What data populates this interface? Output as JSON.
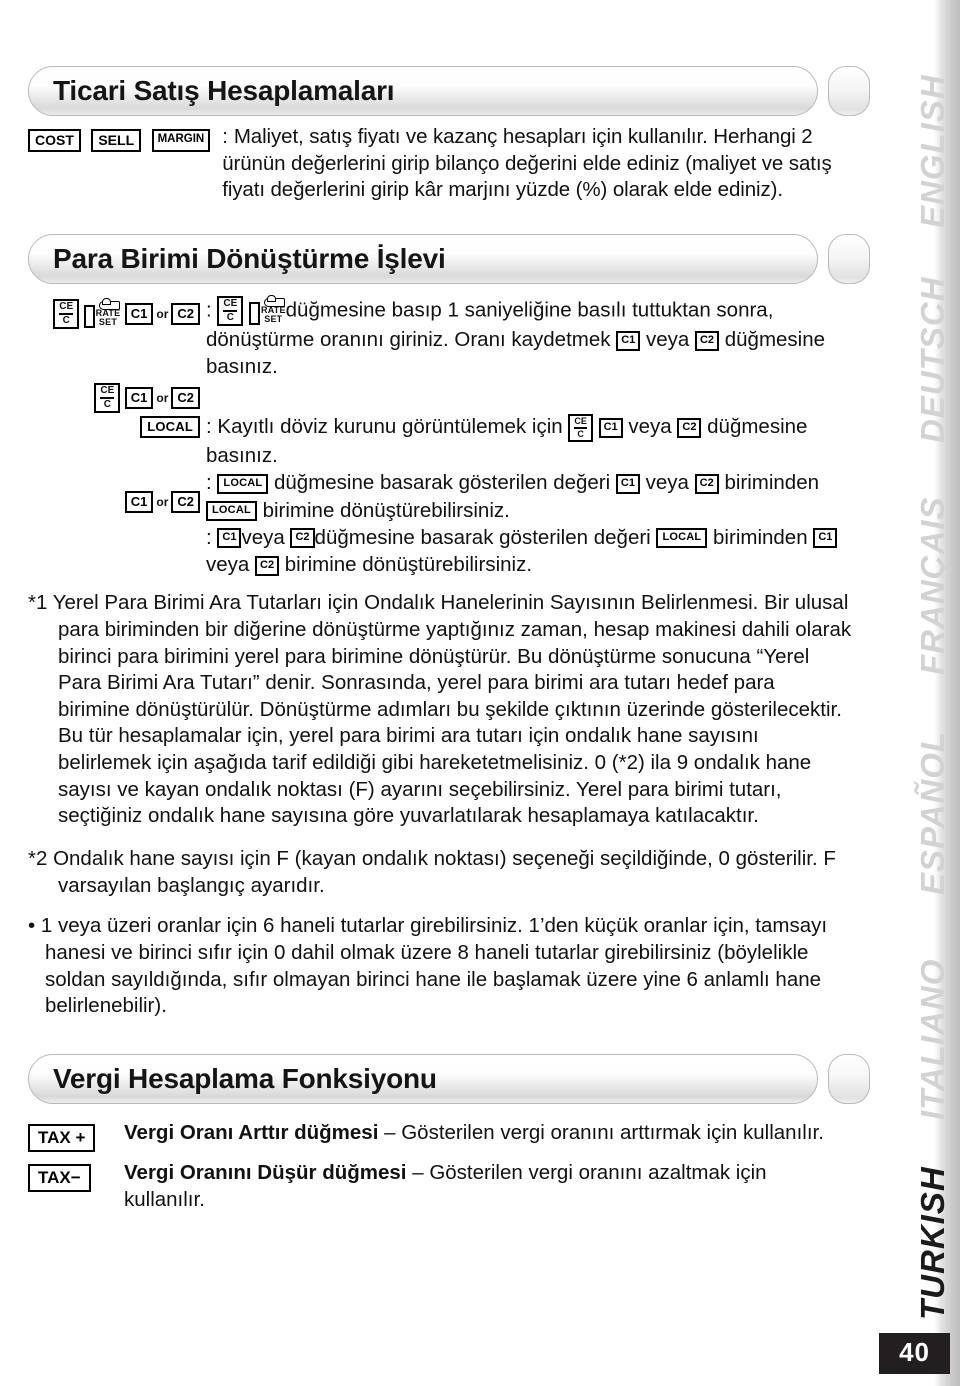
{
  "page": {
    "number": "40"
  },
  "language_rail": {
    "items": [
      {
        "label": "ENGLISH",
        "active": false
      },
      {
        "label": "DEUTSCH",
        "active": false
      },
      {
        "label": "FRANÇAIS",
        "active": false
      },
      {
        "label": "ESPAÑOL",
        "active": false
      },
      {
        "label": "ITALIANO",
        "active": false
      },
      {
        "label": "TURKISH",
        "active": true
      }
    ],
    "inactive_color": "#d2d2d2",
    "active_color": "#1b1b1b"
  },
  "sections": {
    "sales": {
      "heading": "Ticari Satış Hesaplamaları",
      "keys": [
        {
          "label": "COST"
        },
        {
          "label": "SELL"
        },
        {
          "label": "MARGIN"
        }
      ],
      "colon": ":",
      "description": "Maliyet, satış fiyatı ve kazanç hesapları için kullanılır. Herhangi 2 ürünün değerlerini girip bilanço değerini elde ediniz (maliyet ve satış fiyatı değerlerini girip kâr marjını yüzde (%) olarak elde ediniz)."
    },
    "currency": {
      "heading": "Para Birimi Dönüştürme İşlevi",
      "keys": {
        "ce_top": "CE",
        "ce_bottom": "C",
        "rate_line1": "RATE",
        "rate_line2": "SET",
        "c1": "C1",
        "c2": "C2",
        "or": "or",
        "local": "LOCAL"
      },
      "rows": [
        {
          "colon": ":",
          "text_a": "düğmesine basıp 1 saniyeliğine basılı tuttuktan sonra, dönüştürme oranını giriniz. Oranı kaydetmek",
          "text_b": "veya",
          "text_c": "düğmesine basınız."
        },
        {
          "colon": ":",
          "text_a": "Kayıtlı döviz kurunu görüntülemek için",
          "text_b": "veya",
          "text_c": "düğmesine basınız."
        },
        {
          "colon": ":",
          "text_a": "düğmesine basarak gösterilen değeri",
          "text_b": "veya",
          "text_c": "biriminden",
          "text_d": "birimine dönüştürebilirsiniz."
        },
        {
          "colon": ":",
          "text_a": "veya",
          "text_b": "düğmesine basarak gösterilen değeri",
          "text_c": "biriminden",
          "text_d": "veya",
          "text_e": "birimine dönüştürebilirsiniz."
        }
      ],
      "note1": "*1 Yerel Para Birimi Ara Tutarları için Ondalık Hanelerinin Sayısının Belirlenmesi. Bir ulusal para biriminden bir diğerine dönüştürme yaptığınız zaman, hesap makinesi dahili olarak birinci para birimini yerel para birimine dönüştürür. Bu dönüştürme sonucuna “Yerel Para Birimi Ara Tutarı” denir. Sonrasında, yerel para birimi ara tutarı hedef para birimine dönüştürülür. Dönüştürme adımları bu şekilde çıktının üzerinde gösterilecektir. Bu tür hesaplamalar için, yerel para birimi ara tutarı için ondalık hane sayısını belirlemek için aşağıda tarif edildiği gibi hareketetmelisiniz. 0 (*2) ila 9 ondalık hane sayısı ve kayan ondalık noktası (F) ayarını seçebilirsiniz. Yerel para birimi tutarı, seçtiğiniz ondalık hane sayısına göre yuvarlatılarak hesaplamaya katılacaktır.",
      "note2": "*2 Ondalık hane sayısı için F (kayan ondalık noktası) seçeneği seçildiğinde, 0 gösterilir. F varsayılan başlangıç ayarıdır.",
      "bullet1": "• 1 veya üzeri oranlar için 6 haneli tutarlar girebilirsiniz. 1’den küçük oranlar için, tamsayı hanesi ve birinci sıfır için 0 dahil olmak üzere 8 haneli tutarlar girebilirsiniz (böylelikle soldan sayıldığında, sıfır olmayan birinci hane ile başlamak üzere yine 6 anlamlı hane belirlenebilir)."
    },
    "tax": {
      "heading": "Vergi Hesaplama Fonksiyonu",
      "rows": [
        {
          "key": "TAX +",
          "bold": "Vergi Oranı Arttır düğmesi",
          "dash": " – ",
          "text": "Gösterilen vergi oranını arttırmak için kullanılır."
        },
        {
          "key": "TAX−",
          "bold": "Vergi Oranını Düşür düğmesi",
          "dash": " – ",
          "text": "Gösterilen vergi oranını azaltmak için kullanılır."
        }
      ]
    }
  }
}
